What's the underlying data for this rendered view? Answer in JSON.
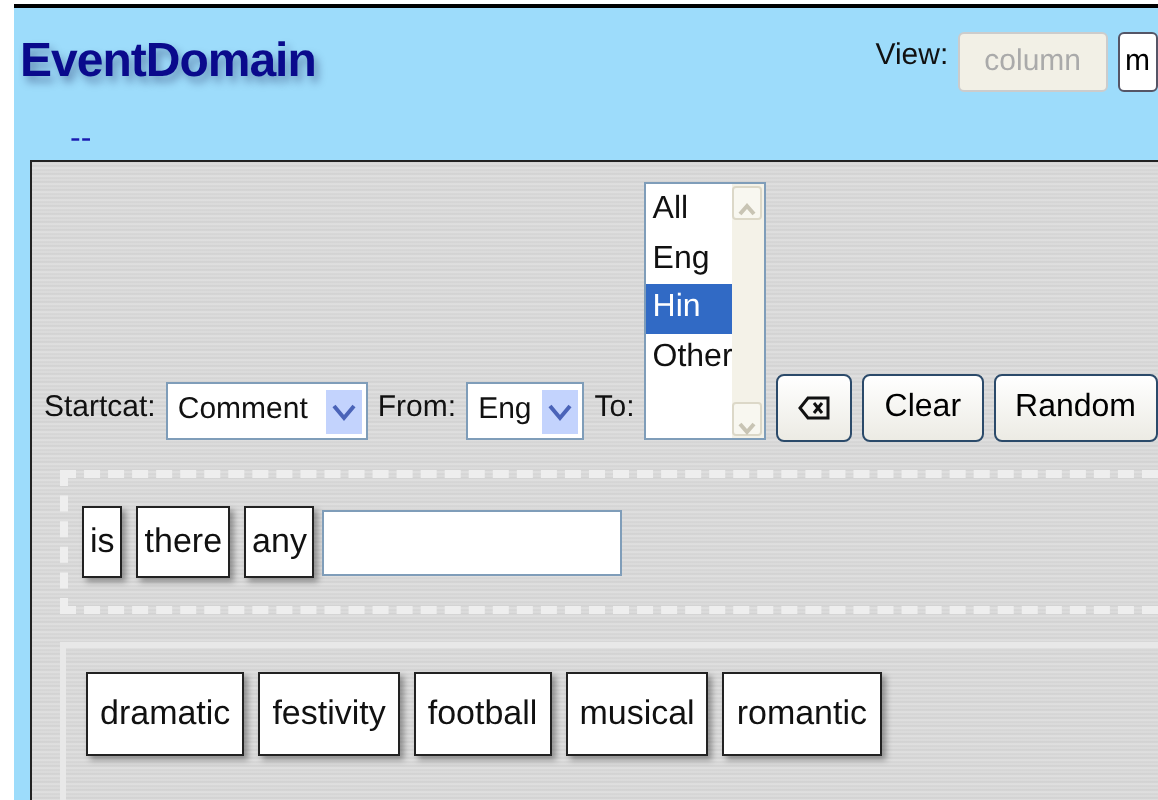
{
  "header": {
    "title": "EventDomain",
    "view_label": "View:",
    "view_buttons": [
      {
        "label": "column",
        "disabled": true
      },
      {
        "label": "m",
        "disabled": false
      }
    ]
  },
  "subtitle": "--",
  "controls": {
    "startcat_label": "Startcat:",
    "startcat": "Comment",
    "from_label": "From:",
    "from": "Eng",
    "to_label": "To:",
    "to_options": [
      {
        "label": "All",
        "selected": false
      },
      {
        "label": "Eng",
        "selected": false
      },
      {
        "label": "Hin",
        "selected": true
      },
      {
        "label": "Other",
        "selected": false
      }
    ],
    "buttons": [
      {
        "kind": "backspace"
      },
      {
        "kind": "text",
        "label": "Clear"
      },
      {
        "kind": "text",
        "label": "Random"
      }
    ]
  },
  "sentence": {
    "words": [
      "is",
      "there",
      "any"
    ]
  },
  "suggestions": [
    "dramatic",
    "festivity",
    "football",
    "musical",
    "romantic"
  ]
}
